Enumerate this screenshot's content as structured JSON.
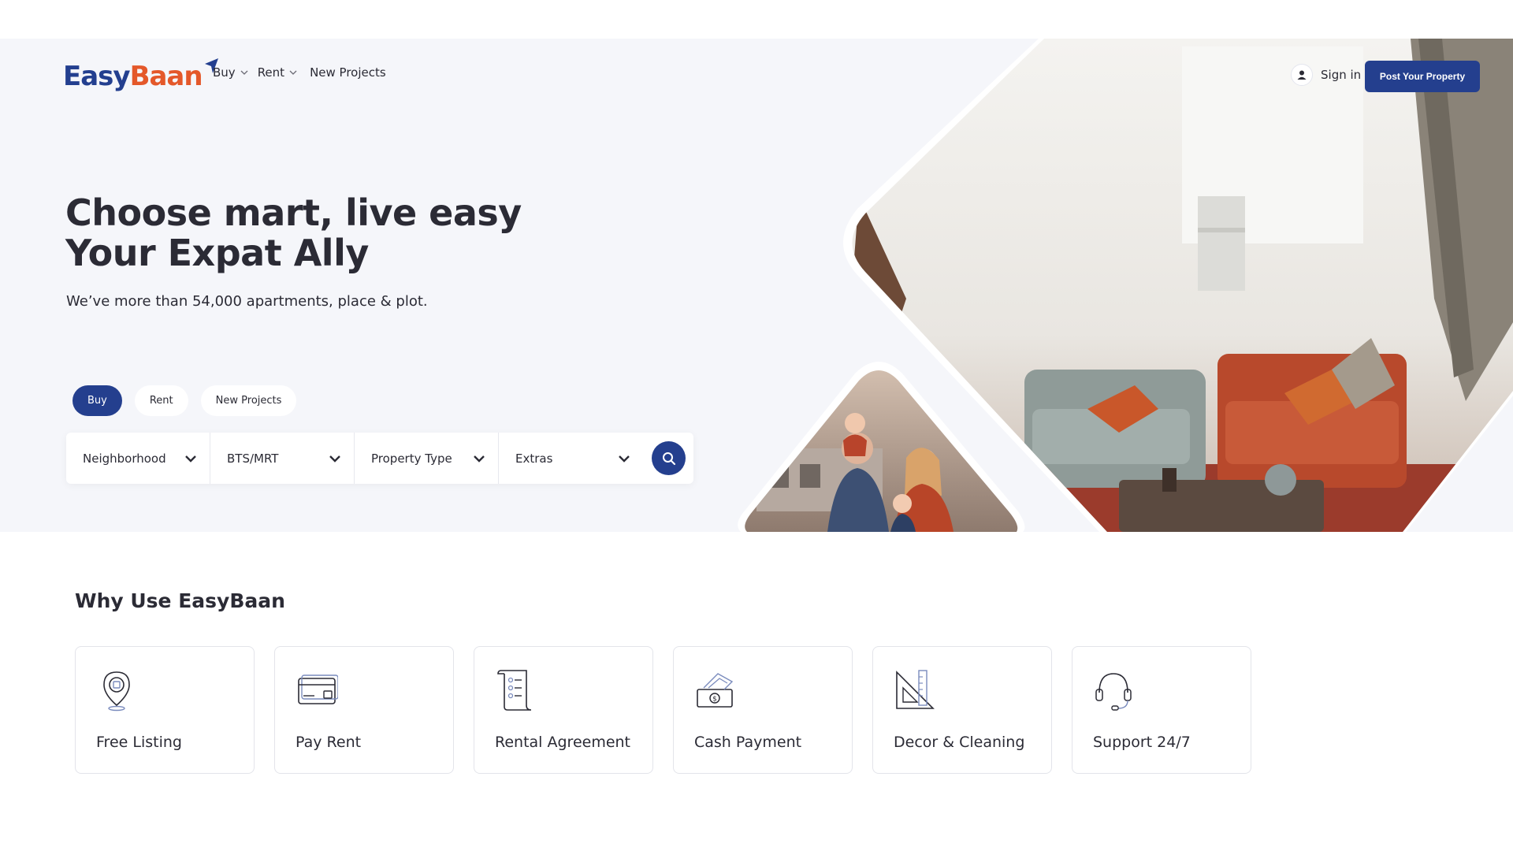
{
  "brand": {
    "name_part1": "Easy",
    "name_part2": "Baan",
    "accent": "#243f8e",
    "orange": "#e4582a"
  },
  "nav": {
    "items": [
      {
        "label": "Buy",
        "icon": "chevron-down-icon"
      },
      {
        "label": "Rent",
        "icon": "chevron-down-icon"
      },
      {
        "label": "New Projects"
      }
    ],
    "sign_in": "Sign in",
    "post_property": "Post Your Property"
  },
  "hero": {
    "headline_line1": "Choose mart, live easy",
    "headline_line2": "Your Expat Ally",
    "subline": "We’ve more than 54,000 apartments, place & plot.",
    "tabs": [
      {
        "label": "Buy",
        "active": true
      },
      {
        "label": "Rent",
        "active": false
      },
      {
        "label": "New Projects",
        "active": false
      }
    ],
    "filters": [
      {
        "label": "Neighborhood"
      },
      {
        "label": "BTS/MRT"
      },
      {
        "label": "Property Type"
      },
      {
        "label": "Extras"
      }
    ]
  },
  "why": {
    "title": "Why Use EasyBaan",
    "cards": [
      {
        "label": "Free Listing",
        "icon": "location-pin-icon"
      },
      {
        "label": "Pay Rent",
        "icon": "credit-card-icon"
      },
      {
        "label": "Rental Agreement",
        "icon": "document-scroll-icon"
      },
      {
        "label": "Cash Payment",
        "icon": "cash-icon"
      },
      {
        "label": "Decor & Cleaning",
        "icon": "ruler-triangle-icon"
      },
      {
        "label": "Support 24/7",
        "icon": "headset-icon"
      }
    ]
  }
}
